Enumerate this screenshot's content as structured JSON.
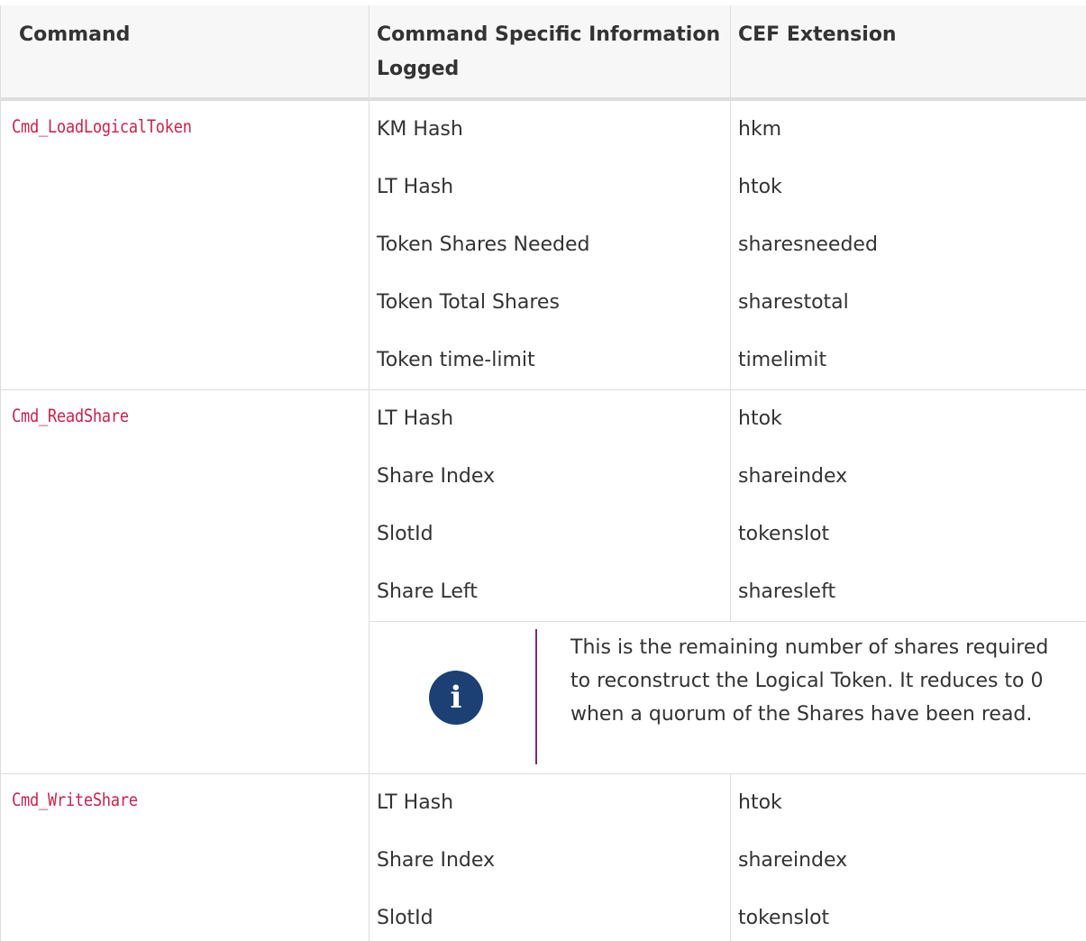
{
  "header": {
    "command": "Command",
    "info": "Command Specific Information Logged",
    "cef": "CEF Extension"
  },
  "groups": [
    {
      "command": "Cmd_LoadLogicalToken",
      "rows": [
        {
          "info": "KM Hash",
          "cef": "hkm"
        },
        {
          "info": "LT Hash",
          "cef": "htok"
        },
        {
          "info": "Token Shares Needed",
          "cef": "sharesneeded"
        },
        {
          "info": "Token Total Shares",
          "cef": "sharestotal"
        },
        {
          "info": "Token time-limit",
          "cef": "timelimit"
        }
      ]
    },
    {
      "command": "Cmd_ReadShare",
      "rows": [
        {
          "info": "LT Hash",
          "cef": "htok"
        },
        {
          "info": "Share Index",
          "cef": "shareindex"
        },
        {
          "info": "SlotId",
          "cef": "tokenslot"
        },
        {
          "info": "Share Left",
          "cef": "sharesleft"
        }
      ],
      "note": {
        "icon": "info-icon",
        "text": "This is the remaining number of shares required to reconstruct the Logical Token. It reduces to 0 when a quorum of the Shares have been read."
      }
    },
    {
      "command": "Cmd_WriteShare",
      "rows": [
        {
          "info": "LT Hash",
          "cef": "htok"
        },
        {
          "info": "Share Index",
          "cef": "shareindex"
        },
        {
          "info": "SlotId",
          "cef": "tokenslot"
        }
      ]
    }
  ],
  "colors": {
    "code": "#c7254e",
    "note_icon": "#1c3f74",
    "note_divider": "#7b2d6b",
    "header_bg": "#f7f7f7"
  }
}
